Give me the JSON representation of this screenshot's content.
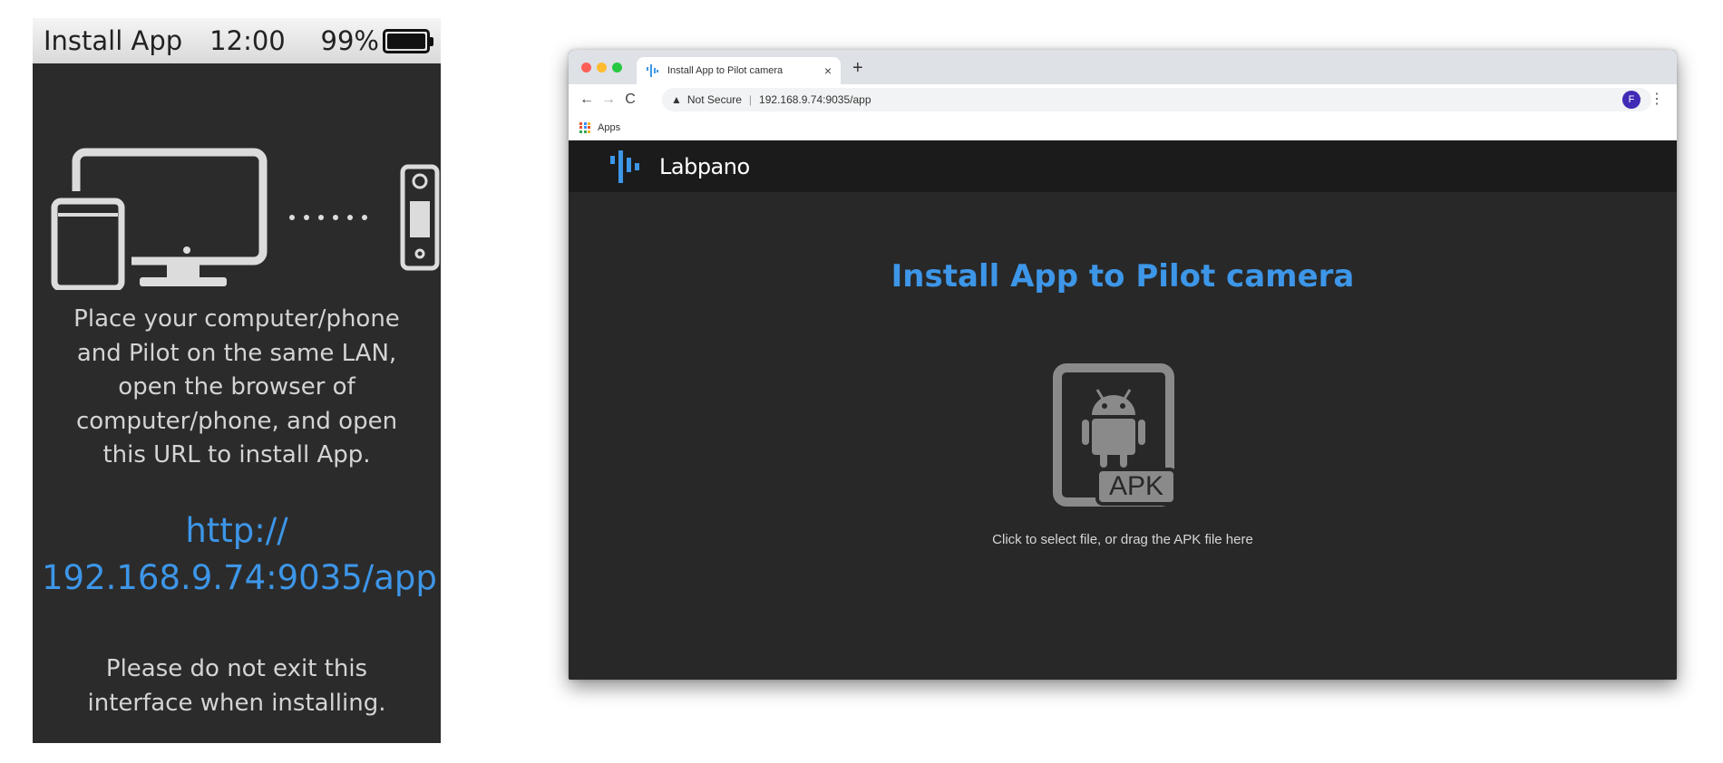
{
  "device": {
    "status_bar": {
      "title": "Install App",
      "time": "12:00",
      "battery": "99%"
    },
    "instructions_lines": [
      "Place your computer/phone",
      "and Pilot on the same LAN,",
      "open the browser of",
      "computer/phone, and open",
      "this URL to install App."
    ],
    "url_lines": [
      "http://",
      "192.168.9.74:9035/app"
    ],
    "warning_lines": [
      "Please do not exit this",
      "interface when installing."
    ],
    "icons": [
      "tablet-icon",
      "monitor-icon",
      "pilot-camera-icon"
    ]
  },
  "browser": {
    "tab": {
      "title": "Install App to Pilot camera",
      "close": "×"
    },
    "new_tab": "+",
    "nav": {
      "back": "←",
      "forward": "→",
      "reload": "C"
    },
    "address_bar": {
      "security_label": "Not Secure",
      "url": "192.168.9.74:9035/app"
    },
    "profile_initial": "F",
    "bookmarks": {
      "apps_label": "Apps"
    }
  },
  "page": {
    "brand": "Labpano",
    "title": "Install App to Pilot camera",
    "upload_badge": "APK",
    "upload_hint": "Click to select file, or drag the APK file here"
  },
  "colors": {
    "accent_blue": "#3d96e8",
    "page_bg": "#282828",
    "header_bg": "#1b1b1b",
    "device_bg": "#2b2b2b"
  }
}
